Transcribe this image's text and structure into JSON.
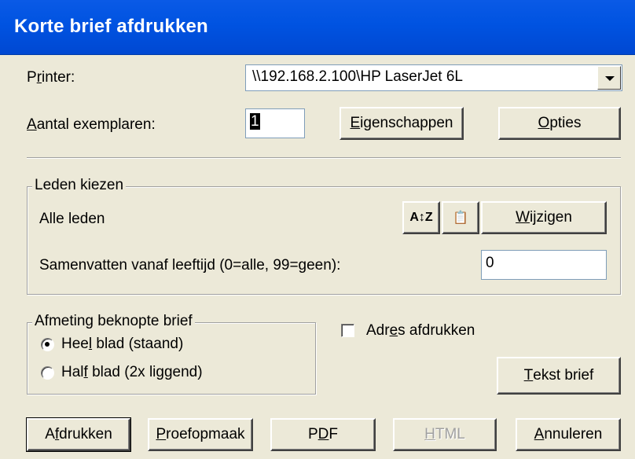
{
  "window": {
    "title": "Korte brief afdrukken"
  },
  "printer": {
    "label_pre": "P",
    "label_ul": "r",
    "label_post": "inter:",
    "value": "\\\\192.168.2.100\\HP LaserJet 6L"
  },
  "copies": {
    "label_ul": "A",
    "label_post": "antal exemplaren:",
    "value": "1"
  },
  "buttons": {
    "properties": {
      "ul": "E",
      "rest": "igenschappen"
    },
    "options": {
      "ul": "O",
      "rest": "pties"
    },
    "sort_icon_label": "A↕Z",
    "clipboard_icon_label": "📋",
    "change": {
      "ul": "W",
      "rest": "ijzigen"
    },
    "letter_text": {
      "ul": "T",
      "rest": "ekst brief"
    },
    "print": {
      "pre": "A",
      "ul": "f",
      "rest": "drukken"
    },
    "proof": {
      "ul": "P",
      "rest": "roefopmaak"
    },
    "pdf": {
      "pre": "P",
      "ul": "D",
      "rest": "F"
    },
    "html": {
      "ul": "H",
      "rest": "TML"
    },
    "cancel": {
      "ul": "A",
      "rest": "nnuleren"
    }
  },
  "members": {
    "legend": "Leden kiezen",
    "selection": "Alle leden",
    "age_label": "Samenvatten vanaf leeftijd (0=alle, 99=geen):",
    "age_value": "0"
  },
  "size": {
    "legend": "Afmeting beknopte brief",
    "full": {
      "pre": "Hee",
      "ul": "l",
      "rest": " blad (staand)",
      "selected": true
    },
    "half": {
      "pre": "Hal",
      "ul": "f",
      "rest": " blad (2x liggend)",
      "selected": false
    }
  },
  "address": {
    "pre": "Adr",
    "ul": "e",
    "rest": "s afdrukken",
    "checked": false
  }
}
